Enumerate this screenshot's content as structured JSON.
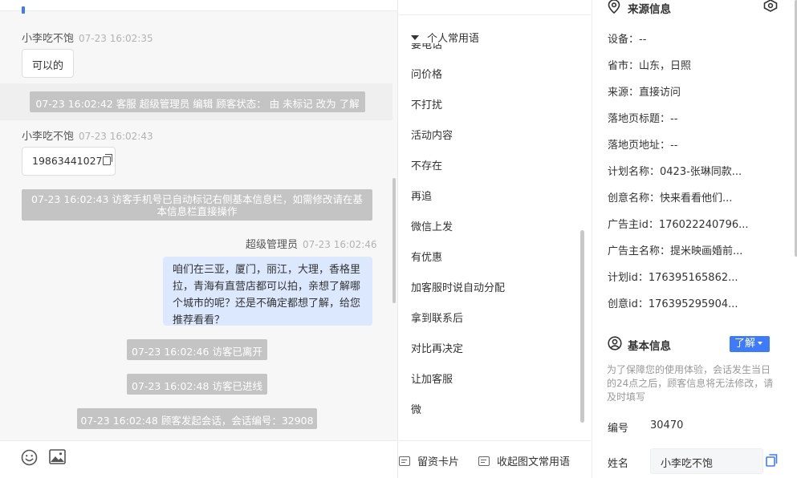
{
  "chat": {
    "messages": [
      {
        "sender": "小李吃不饱",
        "time": "07-23 16:02:35",
        "text": "可以的"
      },
      {
        "system": "07-23 16:02:42 客服 超级管理员 编辑 顾客状态： 由 未标记 改为 了解"
      },
      {
        "sender": "小李吃不饱",
        "time": "07-23 16:02:43",
        "text": "19863441027"
      },
      {
        "system": "07-23 16:02:43 访客手机号已自动标记右侧基本信息栏，如需修改请在基本信息栏直接操作"
      },
      {
        "sender": "超级管理员",
        "time": "07-23 16:02:46",
        "text": "咱们在三亚，厦门，丽江，大理，香格里拉，青海有直营店都可以拍，亲想了解哪个城市的呢？还是不确定都想了解，给您推荐看看？"
      },
      {
        "system": "07-23 16:02:46 访客已离开"
      },
      {
        "system": "07-23 16:02:48 访客已进线"
      },
      {
        "system": "07-23 16:02:48 顾客发起会话，会话编号：32908"
      }
    ],
    "toolbar": {
      "emoji_icon": "smile-icon",
      "image_icon": "image-icon"
    }
  },
  "phrases": {
    "title": "个人常用语",
    "partial_item": "要电话",
    "items": [
      "问价格",
      "不打扰",
      "活动内容",
      "不存在",
      "再追",
      "微信上发",
      "有优惠",
      "加客服时说自动分配",
      "拿到联系后",
      "对比再决定",
      "让加客服",
      "微"
    ],
    "bottom": {
      "card_label": "留资卡片",
      "collapse_label": "收起图文常用语"
    }
  },
  "info": {
    "source": {
      "title": "来源信息",
      "rows": [
        "设备：--",
        "省市：山东，日照",
        "来源：直接访问",
        "落地页标题：--",
        "落地页地址：--",
        "计划名称：0423-张琳同款...",
        "创意名称：快来看看他们...",
        "广告主id：176022240796...",
        "广告主名称：提米映画婚前...",
        "计划id：176395165862...",
        "创意id：176395295904..."
      ]
    },
    "basic": {
      "title": "基本信息",
      "status": "了解",
      "note": "为了保障您的使用体验，会话发生当日的24点之后，顾客信息将无法修改，请及时填写",
      "id_label": "编号",
      "id_value": "30470",
      "name_label": "姓名",
      "name_value": "小李吃不饱"
    }
  },
  "colors": {
    "accent": "#3e7bfa",
    "bubble_blue": "#dbe8fd",
    "system_gray": "#c4c4c4"
  }
}
